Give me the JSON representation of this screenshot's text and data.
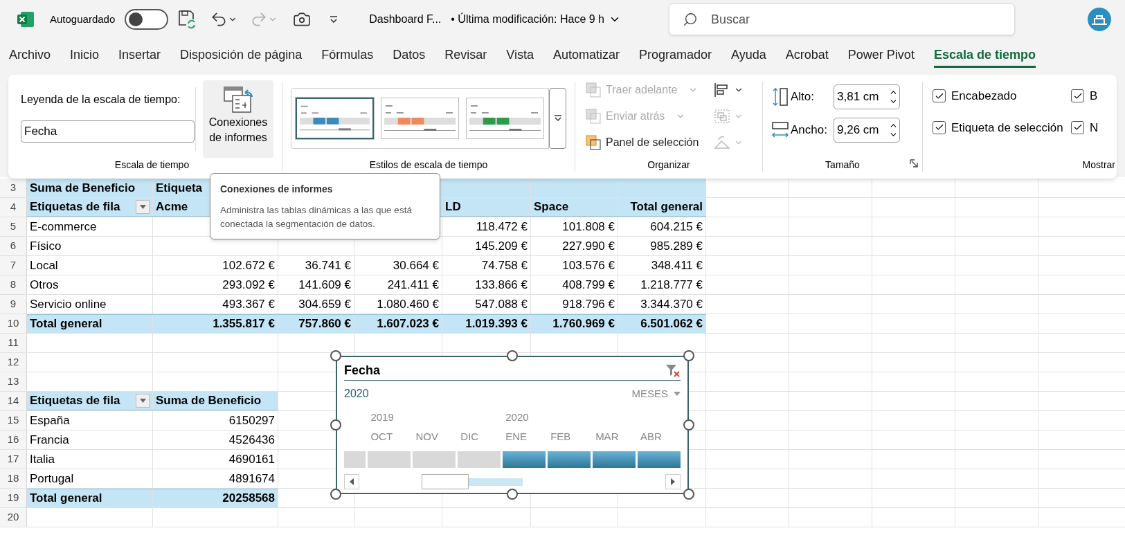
{
  "title_bar": {
    "autosave_label": "Autoguardado",
    "autosave_on": false,
    "document": "Dashboard F...",
    "modified": "• Última modificación: Hace 9 h",
    "search_placeholder": "Buscar"
  },
  "ribbon_tabs": [
    {
      "label": "Archivo",
      "selected": false
    },
    {
      "label": "Inicio",
      "selected": false
    },
    {
      "label": "Insertar",
      "selected": false
    },
    {
      "label": "Disposición de página",
      "selected": false
    },
    {
      "label": "Fórmulas",
      "selected": false
    },
    {
      "label": "Datos",
      "selected": false
    },
    {
      "label": "Revisar",
      "selected": false
    },
    {
      "label": "Vista",
      "selected": false
    },
    {
      "label": "Automatizar",
      "selected": false
    },
    {
      "label": "Programador",
      "selected": false
    },
    {
      "label": "Ayuda",
      "selected": false
    },
    {
      "label": "Acrobat",
      "selected": false
    },
    {
      "label": "Power Pivot",
      "selected": false
    },
    {
      "label": "Escala de tiempo",
      "selected": true
    }
  ],
  "ribbon": {
    "timeline_group": {
      "caption_label": "Leyenda de la escala de tiempo:",
      "caption_value": "Fecha",
      "connections_button": "Conexiones de informes",
      "group_label": "Escala de tiempo"
    },
    "styles_group": {
      "styles": [
        {
          "color": "#3b8bbd",
          "selected": true
        },
        {
          "color": "#f08a5d",
          "selected": false
        },
        {
          "color": "#2e9a4c",
          "selected": false
        }
      ],
      "group_label": "Estilos de escala de tiempo"
    },
    "arrange_group": {
      "items": [
        {
          "label": "Traer adelante",
          "disabled": true
        },
        {
          "label": "Enviar atrás",
          "disabled": true
        },
        {
          "label": "Panel de selección",
          "disabled": false
        }
      ],
      "side_tools": [
        {
          "disabled": false
        },
        {
          "disabled": true
        },
        {
          "disabled": true
        }
      ],
      "group_label": "Organizar"
    },
    "size_group": {
      "fields": [
        {
          "label": "Alto:",
          "value": "3,81 cm"
        },
        {
          "label": "Ancho:",
          "value": "9,26 cm"
        }
      ],
      "group_label": "Tamaño"
    },
    "show_group": {
      "options": [
        {
          "label": "Encabezado",
          "checked": true
        },
        {
          "label": "B",
          "checked": true
        },
        {
          "label": "Etiqueta de selección",
          "checked": true
        },
        {
          "label": "N",
          "checked": true
        }
      ],
      "group_label": "Mostrar"
    }
  },
  "sheet": {
    "rows": [
      {
        "number": "3",
        "kind": "header",
        "cells": [
          "Suma de Beneficio",
          "Etiqueta",
          null,
          null,
          null,
          null,
          null
        ]
      },
      {
        "number": "4",
        "kind": "subheader",
        "filter_button": true,
        "cells": [
          "Etiquetas de fila",
          "Acme",
          null,
          null,
          "LD",
          "Space",
          "Total general"
        ]
      },
      {
        "number": "5",
        "kind": "data",
        "cells": [
          "E-commerce",
          null,
          null,
          null,
          "118.472 €",
          "101.808 €",
          "604.215 €"
        ]
      },
      {
        "number": "6",
        "kind": "data",
        "cells": [
          "Físico",
          null,
          null,
          null,
          "145.209 €",
          "227.990 €",
          "985.289 €"
        ]
      },
      {
        "number": "7",
        "kind": "data",
        "cells": [
          "Local",
          "102.672 €",
          "36.741 €",
          "30.664 €",
          "74.758 €",
          "103.576 €",
          "348.411 €"
        ]
      },
      {
        "number": "8",
        "kind": "data",
        "cells": [
          "Otros",
          "293.092 €",
          "141.609 €",
          "241.411 €",
          "133.866 €",
          "408.799 €",
          "1.218.777 €"
        ]
      },
      {
        "number": "9",
        "kind": "data",
        "cells": [
          "Servicio online",
          "493.367 €",
          "304.659 €",
          "1.080.460 €",
          "547.088 €",
          "918.796 €",
          "3.344.370 €"
        ]
      },
      {
        "number": "10",
        "kind": "total",
        "cells": [
          "Total general",
          "1.355.817 €",
          "757.860 €",
          "1.607.023 €",
          "1.019.393 €",
          "1.760.969 €",
          "6.501.062 €"
        ]
      },
      {
        "number": "11",
        "kind": "empty"
      },
      {
        "number": "12",
        "kind": "empty"
      },
      {
        "number": "13",
        "kind": "empty"
      },
      {
        "number": "14",
        "kind": "subheader",
        "filter_button": true,
        "cells": [
          "Etiquetas de fila",
          "Suma de Beneficio"
        ]
      },
      {
        "number": "15",
        "kind": "data",
        "cells": [
          "España",
          "6150297"
        ]
      },
      {
        "number": "16",
        "kind": "data",
        "cells": [
          "Francia",
          "4526436"
        ]
      },
      {
        "number": "17",
        "kind": "data",
        "cells": [
          "Italia",
          "4690161"
        ]
      },
      {
        "number": "18",
        "kind": "data",
        "cells": [
          "Portugal",
          "4891674"
        ]
      },
      {
        "number": "19",
        "kind": "total",
        "cells": [
          "Total general",
          "20258568"
        ]
      },
      {
        "number": "20",
        "kind": "empty"
      }
    ]
  },
  "tooltip": {
    "title": "Conexiones de informes",
    "text": "Administra las tablas dinámicas a las que está conectada la segmentación de datos."
  },
  "timeline": {
    "title": "Fecha",
    "selection": "2020",
    "level": "MESES",
    "periods": [
      {
        "partial": true,
        "selected": false
      },
      {
        "year": "2019",
        "label": "OCT",
        "selected": false
      },
      {
        "label": "NOV",
        "selected": false
      },
      {
        "label": "DIC",
        "selected": false
      },
      {
        "year": "2020",
        "label": "ENE",
        "selected": true
      },
      {
        "label": "FEB",
        "selected": true
      },
      {
        "label": "MAR",
        "selected": true
      },
      {
        "label": "ABR",
        "selected": true
      }
    ]
  }
}
